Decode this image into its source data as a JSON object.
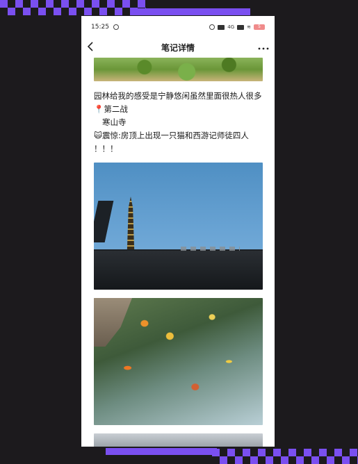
{
  "status_bar": {
    "time": "15:25",
    "signal_text": "4G",
    "battery": "5"
  },
  "nav": {
    "back_icon": "chevron-left-icon",
    "title": "笔记详情",
    "more_icon": "more-dots-icon"
  },
  "note": {
    "paragraph_1": "园林给我的感受是宁静悠闲虽然里面很热人很多",
    "location_line": "📍第二战",
    "place_line": "寒山寺",
    "surprise_line": "🙀震惊:房顶上出现一只猫和西游记师徒四人",
    "exclaim_line": "！！！"
  },
  "images": [
    {
      "name": "lotus-pond-photo"
    },
    {
      "name": "temple-roof-photo"
    },
    {
      "name": "koi-pond-photo"
    },
    {
      "name": "next-photo"
    }
  ],
  "colors": {
    "accent": "#7a4ff0",
    "background": "#1c1a1d"
  }
}
